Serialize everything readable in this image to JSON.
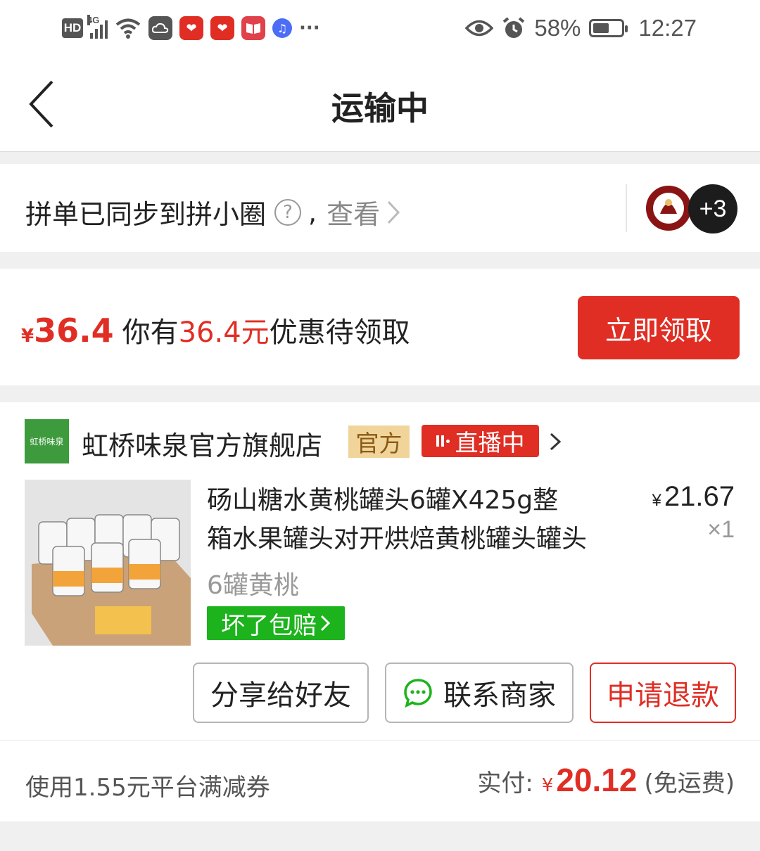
{
  "status_bar": {
    "hd": "HD",
    "network": "4G",
    "battery": "58%",
    "battery_level": 0.58,
    "time": "12:27",
    "more": "···",
    "icons": [
      "wifi-icon",
      "cloud-icon",
      "pinduoduo-icon",
      "pinduoduo-icon",
      "book-icon",
      "music-icon",
      "eye-icon",
      "alarm-icon",
      "battery-icon"
    ]
  },
  "header": {
    "title": "运输中",
    "back_icon": "chevron-left-icon"
  },
  "sync": {
    "text": "拼单已同步到拼小圈",
    "help": "?",
    "comma": ",",
    "view": "查看",
    "more_count": "+3"
  },
  "coupon": {
    "yen": "¥",
    "amount": "36.4",
    "text_prefix": "你有",
    "text_amount": "36.4元",
    "text_suffix": "优惠待领取",
    "claim_button": "立即领取"
  },
  "order": {
    "shop_logo_text": "虹桥味泉",
    "shop_name": "虹桥味泉官方旗舰店",
    "badge_official": "官方",
    "badge_live": "直播中",
    "product_title_line1": "砀山糖水黄桃罐头6罐X425g整",
    "product_title_line2": "箱水果罐头对开烘焙黄桃罐头罐头",
    "price_currency": "¥",
    "price": "21.67",
    "quantity": "×1",
    "spec": "6罐黄桃",
    "guarantee": "坏了包赔",
    "buttons": {
      "share": "分享给好友",
      "contact": "联系商家",
      "refund": "申请退款"
    },
    "promo": "使用1.55元平台满减券",
    "paid_label": "实付:",
    "paid_currency": "¥",
    "paid_amount": "20.12",
    "shipping": "(免运费)"
  },
  "colors": {
    "accent_red": "#e02e24",
    "guarantee_green": "#1cb31c",
    "official_badge": "#f0d49a"
  }
}
